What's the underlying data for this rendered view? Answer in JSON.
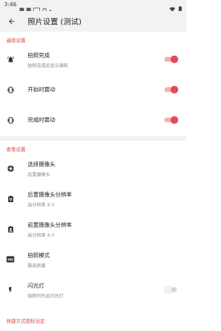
{
  "status_bar": {
    "time": "3:46"
  },
  "app_bar": {
    "title": "照片设置 (测试)"
  },
  "sections": {
    "general": {
      "title": "通用设置",
      "items": [
        {
          "title": "拍照完成",
          "subtitle": "拍照完成后显示通知",
          "toggle": true
        },
        {
          "title": "开始时震动",
          "toggle": true
        },
        {
          "title": "完成时震动",
          "toggle": true
        }
      ]
    },
    "view": {
      "title": "查看设置",
      "items": [
        {
          "title": "选择摄像头",
          "subtitle": "后置摄像头"
        },
        {
          "title": "后置摄像头分辨率",
          "subtitle": "高分辨率 4:3"
        },
        {
          "title": "前置摄像头分辨率",
          "subtitle": "高分辨率 4:3"
        },
        {
          "title": "拍照模式",
          "subtitle": "最高质量"
        },
        {
          "title": "闪光灯",
          "subtitle": "拍照时开启闪光灯",
          "toggle": false
        }
      ]
    },
    "shortcut": {
      "title": "快捷方式图标设定"
    }
  },
  "colors": {
    "accent": "#e24b57",
    "section_title": "#d84a4a",
    "background": "#f2f2f2"
  },
  "icons": {
    "back": "arrow-back-icon",
    "notification": "bell-ring-icon",
    "vibrate": "vibration-icon",
    "camera_switch": "camera-aperture-icon",
    "rear_camera": "camera-rear-icon",
    "front_camera": "camera-front-icon",
    "mode": "hq-icon",
    "flash": "flash-icon"
  }
}
